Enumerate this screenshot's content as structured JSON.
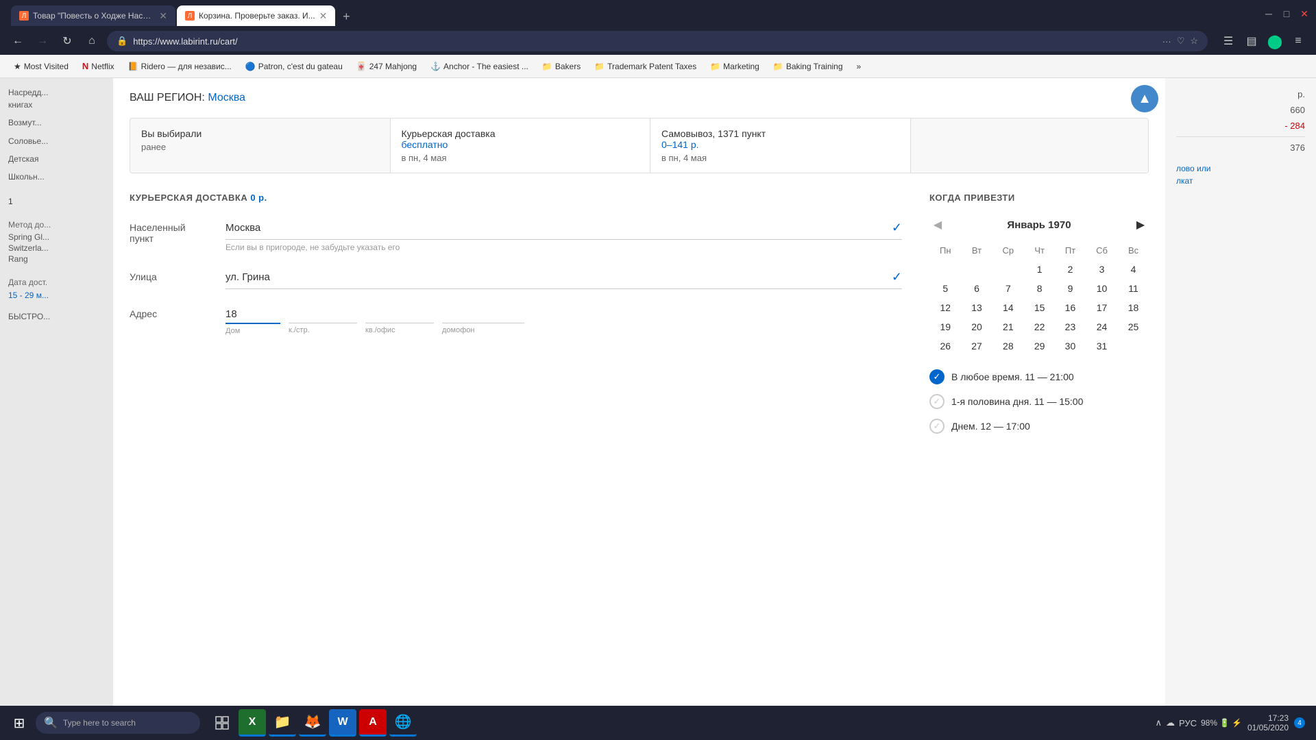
{
  "browser": {
    "tabs": [
      {
        "id": "tab1",
        "title": "Товар \"Повесть о Ходже Насре...",
        "active": false,
        "favicon_color": "#ff6b35"
      },
      {
        "id": "tab2",
        "title": "Корзина. Проверьте заказ. И...",
        "active": true,
        "favicon_color": "#ff6b35"
      }
    ],
    "new_tab_label": "+",
    "url": "https://www.labirint.ru/cart/",
    "nav": {
      "back": "←",
      "forward": "→",
      "refresh": "↻",
      "home": "⌂"
    },
    "toolbar": {
      "more": "···",
      "bookmark_heart": "♡",
      "star": "☆",
      "library": "☰",
      "reader": "▤",
      "account": "👤",
      "menu": "≡"
    }
  },
  "bookmarks": [
    {
      "id": "most_visited",
      "label": "Most Visited",
      "icon": "★"
    },
    {
      "id": "netflix",
      "label": "Netflix",
      "icon": "N",
      "icon_color": "#e50914"
    },
    {
      "id": "ridero",
      "label": "Ridero — для независ...",
      "icon": "📙"
    },
    {
      "id": "patron",
      "label": "Patron, c'est du gateau",
      "icon": "🔵"
    },
    {
      "id": "mahjong",
      "label": "247 Mahjong",
      "icon": "🀄"
    },
    {
      "id": "anchor",
      "label": "Anchor - The easiest ...",
      "icon": "⚓"
    },
    {
      "id": "bakers",
      "label": "Bakers",
      "icon": "📁"
    },
    {
      "id": "trademark",
      "label": "Trademark Patent Taxes",
      "icon": "📁"
    },
    {
      "id": "marketing",
      "label": "Marketing",
      "icon": "📁"
    },
    {
      "id": "baking_training",
      "label": "Baking Training",
      "icon": "📁"
    },
    {
      "id": "more_bookmarks",
      "label": "»",
      "icon": ""
    }
  ],
  "sidebar": {
    "items": [
      {
        "id": "item1",
        "text": "Насредд... книгах"
      },
      {
        "id": "item2",
        "text": "Возмут..."
      },
      {
        "id": "item3",
        "text": "Соловье..."
      },
      {
        "id": "item4",
        "text": "Детская"
      },
      {
        "id": "item5",
        "text": "Школьн..."
      }
    ]
  },
  "right_sidebar": {
    "items": [
      {
        "label": "",
        "value": "р."
      },
      {
        "label": "",
        "value": "660"
      },
      {
        "label": "",
        "value": "- 284"
      },
      {
        "label": "",
        "value": "376"
      }
    ],
    "delivery_date_label": "Дата дост.",
    "delivery_date": "15 - 29 м...",
    "method_label": "Метод до...",
    "method_items": [
      "Spring Gl...",
      "Switzerla...",
      "Rang"
    ],
    "link_text": "лово или",
    "link_text2": "лкат"
  },
  "page": {
    "region_label": "ВАШ РЕГИОН:",
    "region_city": "Москва",
    "delivery_tabs": [
      {
        "id": "prev",
        "title": "Вы выбирали",
        "subtitle": "ранее",
        "price": "",
        "date": ""
      },
      {
        "id": "courier",
        "title": "Курьерская доставка",
        "price": "бесплатно",
        "date": "в пн, 4 мая"
      },
      {
        "id": "pickup",
        "title": "Самовывоз, 1371 пункт",
        "price": "0–141 р.",
        "date": "в пн, 4 мая"
      }
    ],
    "form": {
      "section_title": "КУРЬЕРСКАЯ ДОСТАВКА",
      "section_price": "0 р.",
      "fields": [
        {
          "id": "city",
          "label": "Населенный пункт",
          "value": "Москва",
          "hint": "Если вы в пригороде, не забудьте указать его",
          "has_check": true
        },
        {
          "id": "street",
          "label": "Улица",
          "value": "ул. Грина",
          "hint": "",
          "has_check": true
        },
        {
          "id": "address",
          "label": "Адрес",
          "value": ""
        }
      ],
      "address_parts": {
        "house": "18",
        "house_label": "Дом",
        "building_label": "к./стр.",
        "apt_label": "кв./офис",
        "intercom_label": "домофон"
      }
    },
    "calendar": {
      "title": "КОГДА ПРИВЕЗТИ",
      "month": "Январь 1970",
      "days_of_week": [
        "Пн",
        "Вт",
        "Ср",
        "Чт",
        "Пт",
        "Сб",
        "Вс"
      ],
      "weeks": [
        [
          null,
          null,
          null,
          "1",
          "2",
          "3",
          "4"
        ],
        [
          "5",
          "6",
          "7",
          "8",
          "9",
          "10",
          "11"
        ],
        [
          "12",
          "13",
          "14",
          "15",
          "16",
          "17",
          "18"
        ],
        [
          "19",
          "20",
          "21",
          "22",
          "23",
          "24",
          "25"
        ],
        [
          "26",
          "27",
          "28",
          "29",
          "30",
          "31",
          null
        ]
      ],
      "nav_prev": "◀",
      "nav_next": "▶"
    },
    "time_slots": [
      {
        "id": "anytime",
        "label": "В любое время. 11 — 21:00",
        "selected": true
      },
      {
        "id": "morning",
        "label": "1-я половина дня. 11 — 15:00",
        "selected": false,
        "disabled": true
      },
      {
        "id": "afternoon",
        "label": "Днем. 12 — 17:00",
        "selected": false,
        "disabled": true
      }
    ]
  },
  "taskbar": {
    "search_placeholder": "Type here to search",
    "apps": [
      {
        "id": "task-view",
        "icon": "⊞",
        "active": false
      },
      {
        "id": "excel",
        "icon": "X",
        "active": true,
        "color": "#1e6e2e"
      },
      {
        "id": "files",
        "icon": "📁",
        "active": true
      },
      {
        "id": "firefox",
        "icon": "🦊",
        "active": true
      },
      {
        "id": "word",
        "icon": "W",
        "active": true,
        "color": "#1565c0"
      },
      {
        "id": "acrobat",
        "icon": "A",
        "active": true,
        "color": "#cc0000"
      },
      {
        "id": "chrome",
        "icon": "🌐",
        "active": true
      }
    ],
    "tray": {
      "battery": "98%",
      "time": "17:23",
      "date": "01/05/2020",
      "language": "РУС",
      "notification": "4"
    }
  }
}
